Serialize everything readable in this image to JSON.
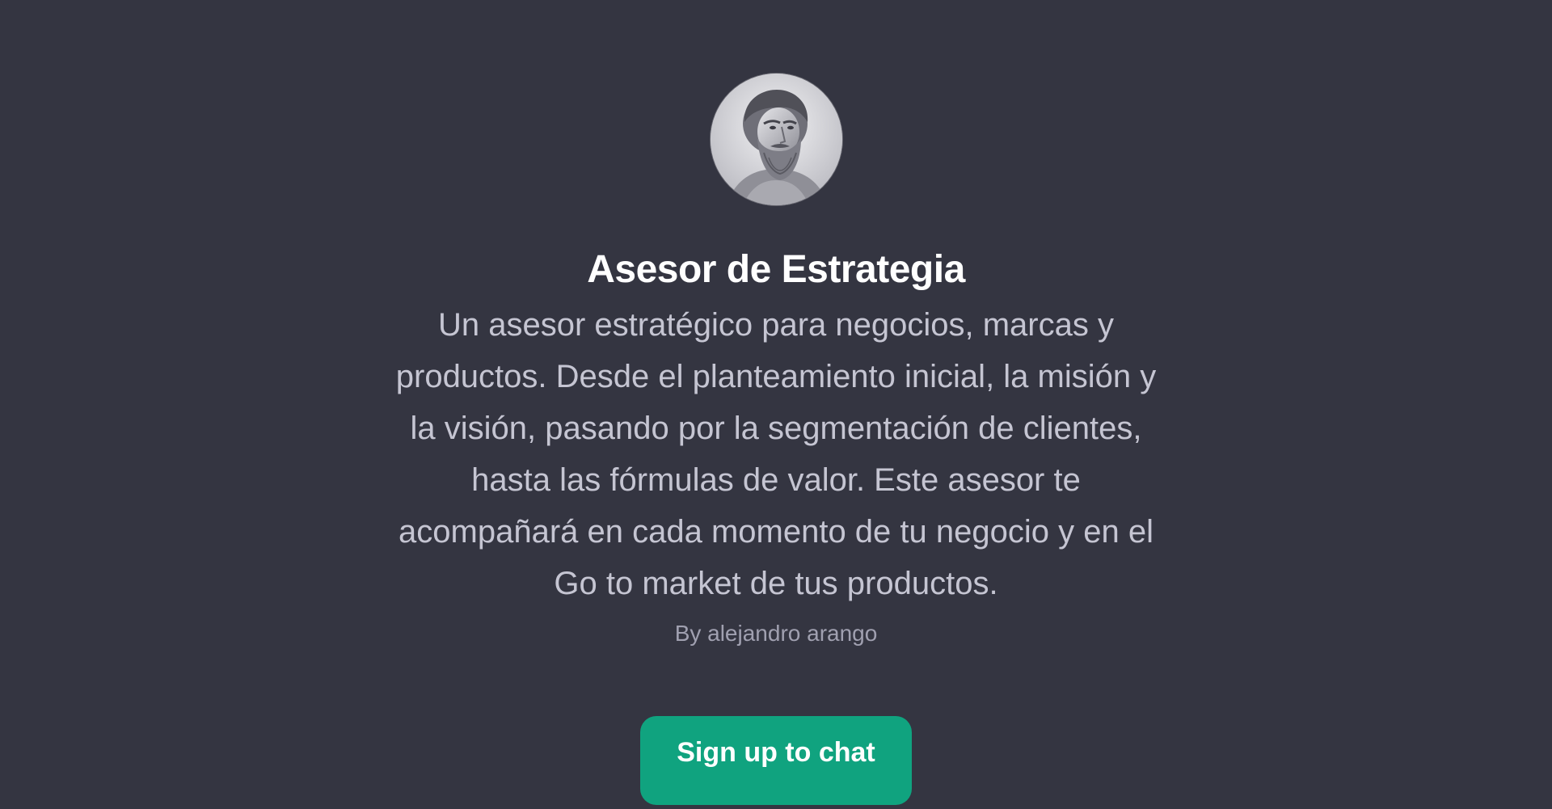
{
  "gpt": {
    "avatar_icon": "bearded-philosopher-bust-icon",
    "title": "Asesor de Estrategia",
    "description": "Un asesor estratégico para negocios, marcas y productos. Desde el planteamiento inicial, la misión y la visión, pasando por la segmentación de clientes, hasta las fórmulas de valor. Este asesor te acompañará en cada momento de tu negocio y en el Go to market de tus productos.",
    "author": "By alejandro arango"
  },
  "cta": {
    "label": "Sign up to chat"
  },
  "colors": {
    "background": "#343541",
    "title": "#ffffff",
    "description": "#c5c5d2",
    "author": "#a0a0b0",
    "button": "#10a37f"
  }
}
